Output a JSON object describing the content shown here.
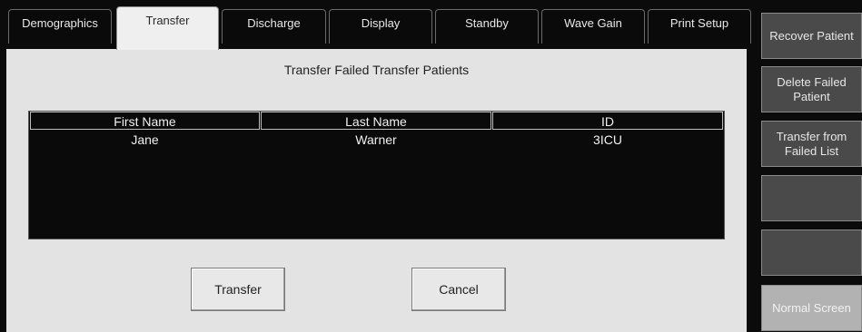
{
  "tabs": [
    {
      "label": "Demographics"
    },
    {
      "label": "Transfer"
    },
    {
      "label": "Discharge"
    },
    {
      "label": "Display"
    },
    {
      "label": "Standby"
    },
    {
      "label": "Wave Gain"
    },
    {
      "label": "Print Setup"
    }
  ],
  "active_tab": "Transfer",
  "panel": {
    "title": "Transfer Failed Transfer Patients",
    "columns": [
      "First Name",
      "Last Name",
      "ID"
    ],
    "rows": [
      {
        "first_name": "Jane",
        "last_name": "Warner",
        "id": "3ICU"
      }
    ],
    "transfer_label": "Transfer",
    "cancel_label": "Cancel"
  },
  "sidebar": {
    "recover_patient": "Recover Patient",
    "delete_failed_patient": "Delete Failed Patient",
    "transfer_from_failed_list": "Transfer from Failed List",
    "normal_screen": "Normal Screen"
  }
}
